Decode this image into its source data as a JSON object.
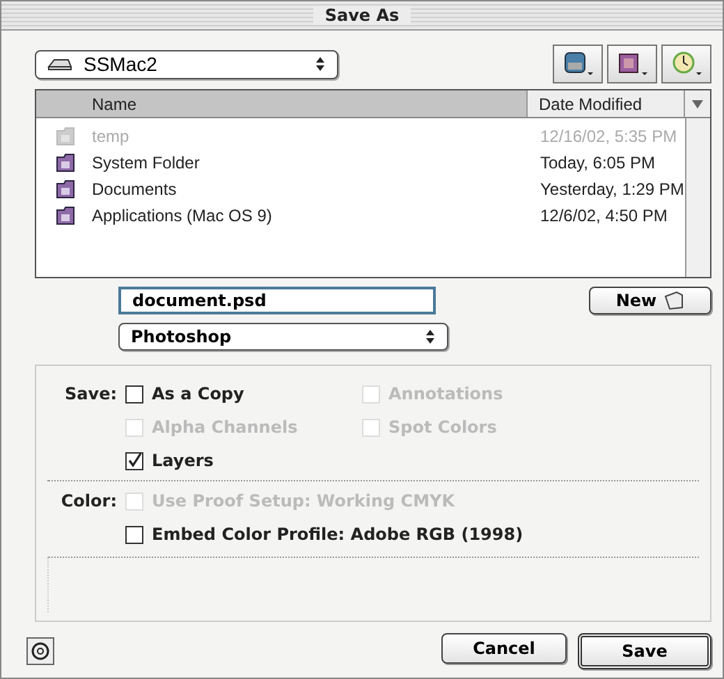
{
  "window": {
    "title": "Save As"
  },
  "location": {
    "value": "SSMac2"
  },
  "file_list": {
    "columns": [
      {
        "label": "Name",
        "selected": true
      },
      {
        "label": "Date Modified",
        "selected": false
      }
    ],
    "rows": [
      {
        "name": "temp",
        "date": "12/16/02, 5:35 PM",
        "disabled": true
      },
      {
        "name": "System Folder",
        "date": "Today, 6:05 PM",
        "disabled": false
      },
      {
        "name": "Documents",
        "date": "Yesterday, 1:29 PM",
        "disabled": false
      },
      {
        "name": "Applications (Mac OS 9)",
        "date": "12/6/02, 4:50 PM",
        "disabled": false
      }
    ]
  },
  "filename": {
    "value": "document.psd"
  },
  "format": {
    "value": "Photoshop"
  },
  "new_button": {
    "label": "New"
  },
  "save_options": {
    "label": "Save:",
    "options": [
      {
        "label": "As a Copy",
        "checked": false,
        "disabled": false
      },
      {
        "label": "Annotations",
        "checked": false,
        "disabled": true
      },
      {
        "label": "Alpha Channels",
        "checked": false,
        "disabled": true
      },
      {
        "label": "Spot Colors",
        "checked": false,
        "disabled": true
      },
      {
        "label": "Layers",
        "checked": true,
        "disabled": false
      }
    ]
  },
  "color_options": {
    "label": "Color:",
    "options": [
      {
        "label": "Use Proof Setup: Working CMYK",
        "checked": false,
        "disabled": true
      },
      {
        "label": "Embed Color Profile: Adobe RGB (1998)",
        "checked": false,
        "disabled": false
      }
    ]
  },
  "buttons": [
    {
      "label": "Cancel",
      "default": false
    },
    {
      "label": "Save",
      "default": true
    }
  ]
}
